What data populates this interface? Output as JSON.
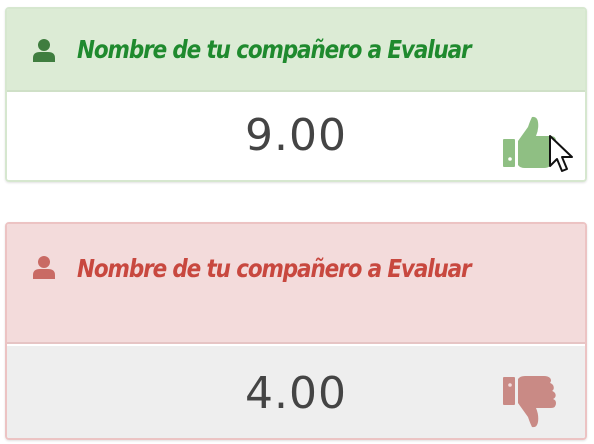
{
  "cards": [
    {
      "title": "Nombre de tu compañero a Evaluar",
      "score": "9.00",
      "status": "approved",
      "accent_color": "#1f8a2e",
      "icon": "thumbs-up-icon"
    },
    {
      "title": "Nombre de tu compañero a Evaluar",
      "score": "4.00",
      "status": "rejected",
      "accent_color": "#c8483f",
      "icon": "thumbs-down-icon"
    }
  ]
}
